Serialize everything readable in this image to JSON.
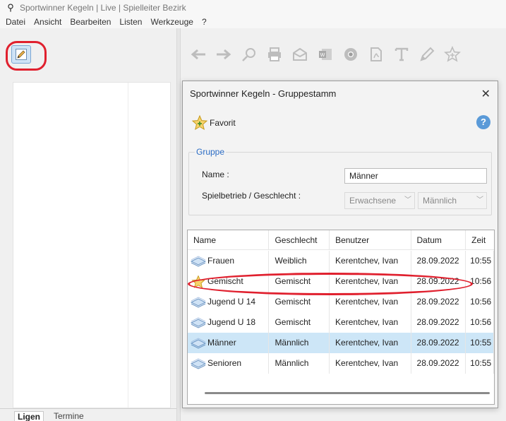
{
  "window": {
    "title": "Sportwinner Kegeln | Live | Spielleiter Bezirk"
  },
  "menu": [
    "Datei",
    "Ansicht",
    "Bearbeiten",
    "Listen",
    "Werkzeuge",
    "?"
  ],
  "left_panel": {
    "tabs": [
      "Ligen",
      "Termine"
    ]
  },
  "toolbar": {
    "icons": [
      "arrow-left-icon",
      "arrow-right-icon",
      "search-icon",
      "print-icon",
      "mail-icon",
      "word-icon",
      "chrome-icon",
      "pdf-icon",
      "text-icon",
      "pencil-icon",
      "star-icon"
    ]
  },
  "dialog": {
    "title": "Sportwinner Kegeln - Gruppestamm",
    "close": "✕",
    "favorite_label": "Favorit",
    "help": "?",
    "group": {
      "legend": "Gruppe",
      "name_label": "Name :",
      "name_value": "Männer",
      "spiel_label": "Spielbetrieb / Geschlecht :",
      "spielbetrieb": "Erwachsene",
      "geschlecht": "Männlich"
    },
    "table": {
      "columns": [
        "Name",
        "Geschlecht",
        "Benutzer",
        "Datum",
        "Zeit"
      ],
      "rows": [
        {
          "name": "Frauen",
          "geschlecht": "Weiblich",
          "benutzer": "Kerentchev, Ivan",
          "datum": "28.09.2022",
          "zeit": "10:55",
          "icon": "layers-icon",
          "selected": false
        },
        {
          "name": "Gemischt",
          "geschlecht": "Gemischt",
          "benutzer": "Kerentchev, Ivan",
          "datum": "28.09.2022",
          "zeit": "10:56",
          "icon": "star-icon",
          "selected": false
        },
        {
          "name": "Jugend U 14",
          "geschlecht": "Gemischt",
          "benutzer": "Kerentchev, Ivan",
          "datum": "28.09.2022",
          "zeit": "10:56",
          "icon": "layers-icon",
          "selected": false
        },
        {
          "name": "Jugend U 18",
          "geschlecht": "Gemischt",
          "benutzer": "Kerentchev, Ivan",
          "datum": "28.09.2022",
          "zeit": "10:56",
          "icon": "layers-icon",
          "selected": false
        },
        {
          "name": "Männer",
          "geschlecht": "Männlich",
          "benutzer": "Kerentchev, Ivan",
          "datum": "28.09.2022",
          "zeit": "10:55",
          "icon": "layers-icon",
          "selected": true
        },
        {
          "name": "Senioren",
          "geschlecht": "Männlich",
          "benutzer": "Kerentchev, Ivan",
          "datum": "28.09.2022",
          "zeit": "10:55",
          "icon": "layers-icon",
          "selected": false
        }
      ]
    }
  },
  "colors": {
    "accent": "#2b6cc4",
    "selection": "#cde6f7",
    "annotation": "#e0202e",
    "star": "#f2c53d"
  }
}
